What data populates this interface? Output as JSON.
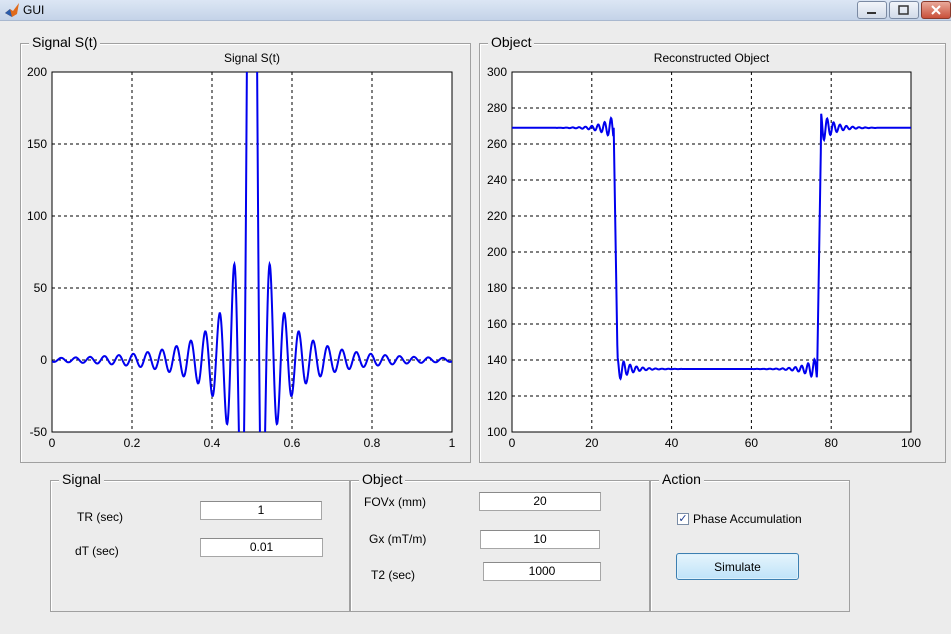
{
  "window": {
    "title": "GUI",
    "buttons": [
      "minimize",
      "maximize",
      "close"
    ]
  },
  "panels": {
    "signal_plot": {
      "legend": "Signal S(t)"
    },
    "object_plot": {
      "legend": "Object"
    }
  },
  "chart_data": [
    {
      "type": "line",
      "title": "Signal S(t)",
      "xlabel": "",
      "ylabel": "",
      "xlim": [
        0,
        1
      ],
      "ylim": [
        -50,
        200
      ],
      "xticks": [
        "0",
        "0.2",
        "0.4",
        "0.6",
        "0.8",
        "1"
      ],
      "yticks": [
        "-50",
        "0",
        "50",
        "100",
        "150",
        "200"
      ],
      "grid": "dashed",
      "color": "#0000ee",
      "series": [
        {
          "shape": "sinc-like echo centred at t=0.5 (peak clipped above 200, side lobes ~ -42 and +15)"
        }
      ]
    },
    {
      "type": "line",
      "title": "Reconstructed Object",
      "xlabel": "",
      "ylabel": "",
      "xlim": [
        0,
        100
      ],
      "ylim": [
        100,
        300
      ],
      "xticks": [
        "0",
        "20",
        "40",
        "60",
        "80",
        "100"
      ],
      "yticks": [
        "100",
        "120",
        "140",
        "160",
        "180",
        "200",
        "220",
        "240",
        "260",
        "280",
        "300"
      ],
      "grid": "dashed",
      "color": "#0000ee",
      "series": [
        {
          "x": [
            0,
            25.5,
            27,
            76.5,
            77.5,
            100
          ],
          "y": [
            269,
            269,
            135,
            135,
            269,
            269
          ]
        }
      ]
    }
  ],
  "signal_group": {
    "legend": "Signal",
    "tr_label": "TR (sec)",
    "tr_value": "1",
    "dt_label": "dT (sec)",
    "dt_value": "0.01"
  },
  "object_group": {
    "legend": "Object",
    "fov_label": "FOVx  (mm)",
    "fov_value": "20",
    "gx_label": "Gx (mT/m)",
    "gx_value": "10",
    "t2_label": "T2 (sec)",
    "t2_value": "1000"
  },
  "action_group": {
    "legend": "Action",
    "phase_label": "Phase Accumulation",
    "phase_checked": true,
    "simulate_label": "Simulate"
  }
}
